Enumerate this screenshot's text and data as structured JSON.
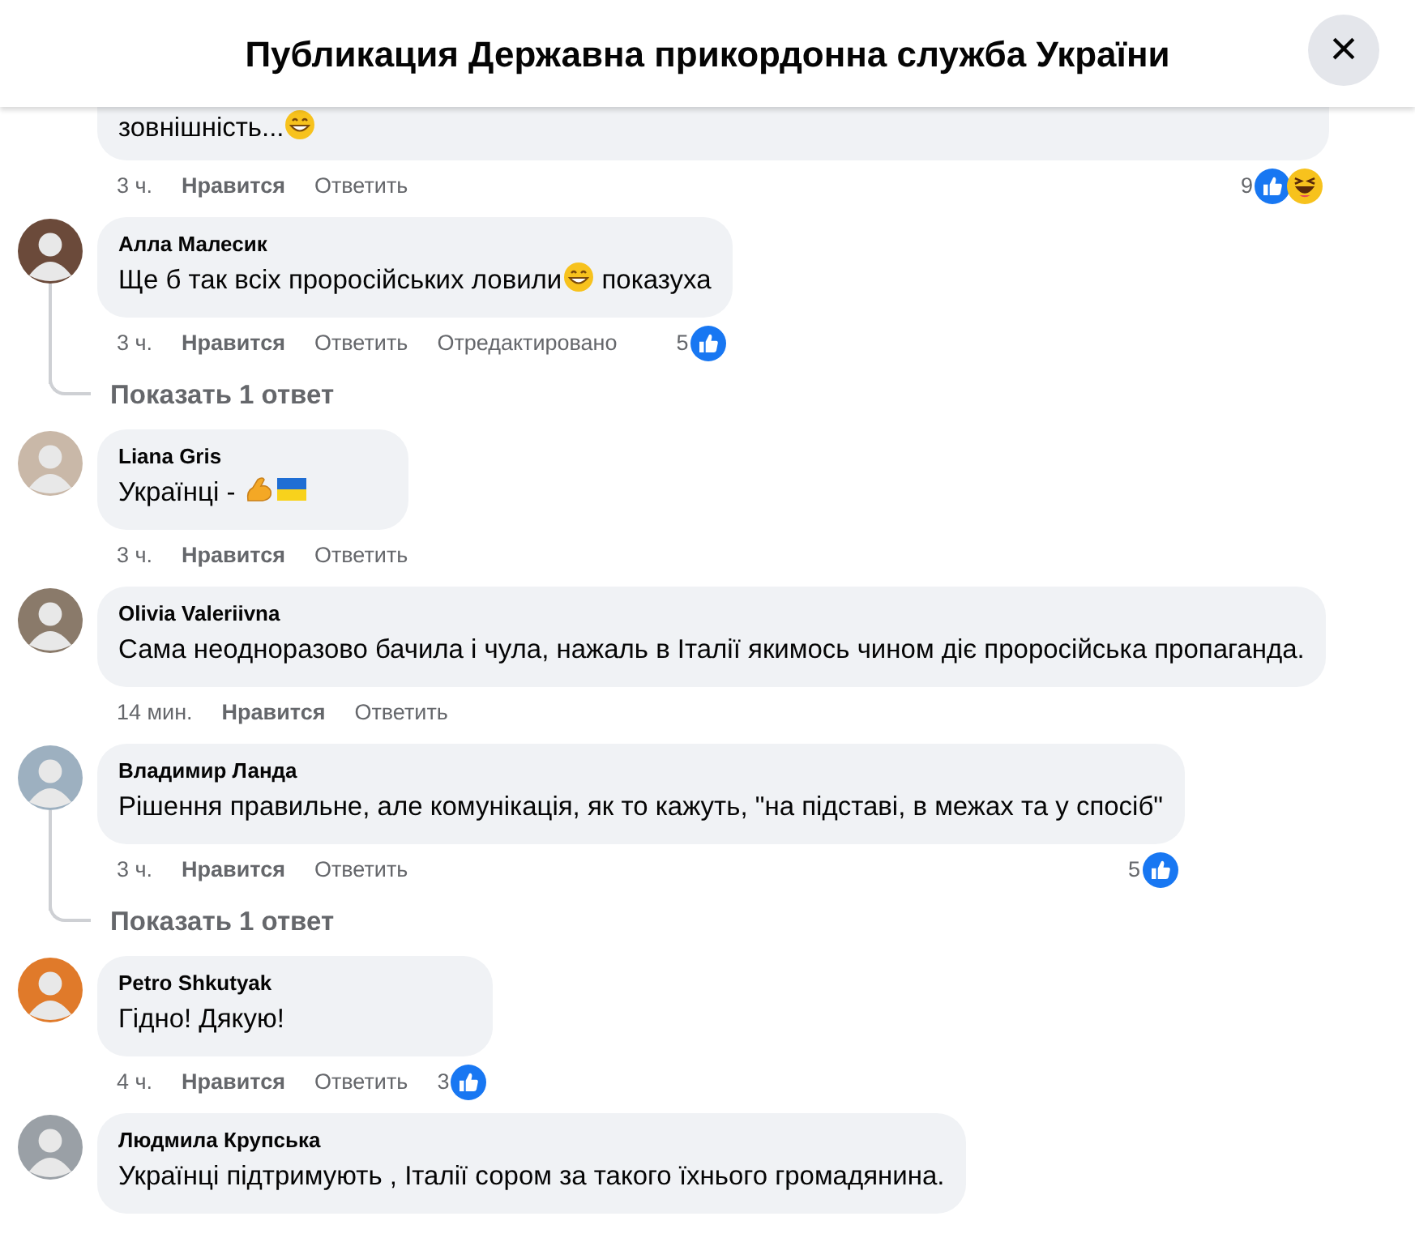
{
  "header": {
    "title": "Публикация Державна прикордонна служба України",
    "close": "×"
  },
  "comments": [
    {
      "kind": "cut",
      "body": [
        {
          "kind": "text",
          "text": "зовнішність..."
        },
        {
          "kind": "grin"
        }
      ],
      "time": "3 ч.",
      "like": "Нравится",
      "reply": "Ответить",
      "reactions": {
        "count": "9",
        "icons": [
          {
            "kind": "like"
          },
          {
            "kind": "haha"
          }
        ]
      }
    },
    {
      "kind": "comment",
      "author": "Алла Малесик",
      "body": [
        {
          "kind": "text",
          "text": "Ще б так всіх проросійських ловили"
        },
        {
          "kind": "grin"
        },
        {
          "kind": "text",
          "text": "показуха"
        }
      ],
      "time": "3 ч.",
      "like": "Нравится",
      "reply": "Ответить",
      "edited": "Отредактировано",
      "reactions": {
        "count": "5",
        "icons": [
          {
            "kind": "like"
          }
        ]
      },
      "replies": "Показать 1 ответ"
    },
    {
      "kind": "comment",
      "author": "Liana Gris",
      "body": [
        {
          "kind": "text",
          "text": "Українці -"
        },
        {
          "kind": "arm"
        },
        {
          "kind": "flag"
        }
      ],
      "time": "3 ч.",
      "like": "Нравится",
      "reply": "Ответить"
    },
    {
      "kind": "comment",
      "author": "Olivia Valeriivna",
      "body": [
        {
          "kind": "text",
          "text": "Сама неодноразово бачила і чула, нажаль в Італії якимось чином діє проросійська пропаганда."
        }
      ],
      "time": "14 мин.",
      "like": "Нравится",
      "reply": "Ответить"
    },
    {
      "kind": "comment",
      "author": "Владимир Ланда",
      "body": [
        {
          "kind": "text",
          "text": "Рішення правильне, але комунікація, як то кажуть, \"на підставі, в межах та у спосіб\""
        }
      ],
      "time": "3 ч.",
      "like": "Нравится",
      "reply": "Ответить",
      "reactions": {
        "count": "5",
        "icons": [
          {
            "kind": "like"
          }
        ]
      },
      "replies": "Показать 1 ответ"
    },
    {
      "kind": "comment",
      "author": "Petro Shkutyak",
      "body": [
        {
          "kind": "text",
          "text": "Гідно! Дякую!"
        }
      ],
      "time": "4 ч.",
      "like": "Нравится",
      "reply": "Ответить",
      "reactions": {
        "count": "3",
        "icons": [
          {
            "kind": "like"
          }
        ]
      }
    },
    {
      "kind": "comment",
      "author": "Людмила Крупська",
      "body": [
        {
          "kind": "text",
          "text": "Українці підтримують , Італії сором за такого їхнього громадянина."
        }
      ]
    }
  ]
}
